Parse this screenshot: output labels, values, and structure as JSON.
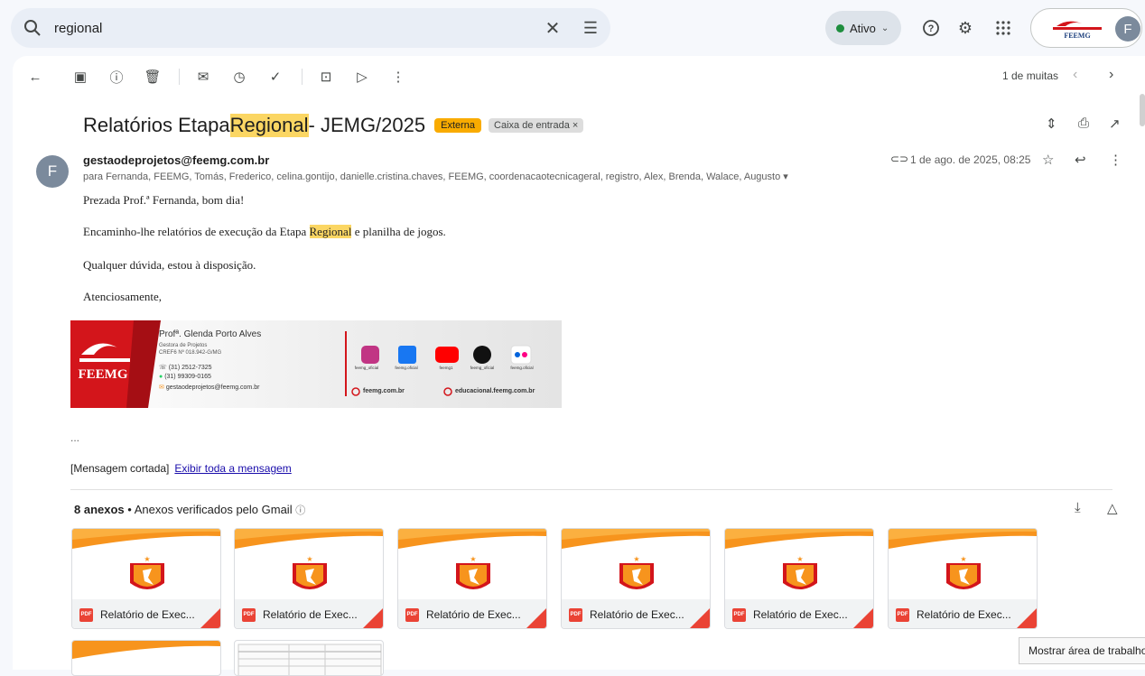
{
  "search": {
    "value": "regional"
  },
  "status": {
    "label": "Ativo"
  },
  "account": {
    "initial": "F",
    "logo_text": "FEEMG"
  },
  "toolbar": {
    "pager": "1 de muitas"
  },
  "subject": {
    "before": "Relatórios Etapa ",
    "highlight": "Regional",
    "after": " - JEMG/2025",
    "badge_external": "Externa",
    "badge_inbox": "Caixa de entrada ×"
  },
  "message": {
    "sender_initial": "F",
    "from": "gestaodeprojetos@feemg.com.br",
    "to": "para Fernanda, FEEMG, Tomás, Frederico, celina.gontijo, danielle.cristina.chaves, FEEMG, coordenacaotecnicageral, registro, Alex, Brenda, Walace, Augusto ▾",
    "date": "1 de ago. de 2025, 08:25",
    "greeting": "Prezada Prof.ª Fernanda, bom dia!",
    "line2_before": "Encaminho-lhe relatórios de execução da Etapa ",
    "line2_highlight": "Regional",
    "line2_after": " e planilha de jogos.",
    "line3": "Qualquer dúvida, estou à disposição.",
    "closing": "Atenciosamente,",
    "ellipsis": "...",
    "cut_text": "[Mensagem cortada]",
    "cut_link": "Exibir toda a mensagem"
  },
  "signature": {
    "name": "Profª. Glenda Porto Alves",
    "role": "Gestora de Projetos",
    "cref": "CREF6 Nº 018.942-G/MG",
    "phone": "(31) 2512-7325",
    "whatsapp": "(31) 99309-0165",
    "email": "gestaodeprojetos@feemg.com.br",
    "social": [
      "feemg_oficial",
      "feemg.oficial",
      "feemg1",
      "feemg_oficial",
      "feemg.oficial"
    ],
    "site1": "feemg.com.br",
    "site2": "educacional.feemg.com.br",
    "logo": "FEEMG"
  },
  "attachments": {
    "count_label": "8 anexos",
    "verified": "• Anexos verificados pelo Gmail",
    "items": [
      {
        "name": "Relatório de Exec..."
      },
      {
        "name": "Relatório de Exec..."
      },
      {
        "name": "Relatório de Exec..."
      },
      {
        "name": "Relatório de Exec..."
      },
      {
        "name": "Relatório de Exec..."
      },
      {
        "name": "Relatório de Exec..."
      }
    ]
  },
  "tooltip": {
    "text": "Mostrar área de trabalho"
  },
  "colors": {
    "highlight": "#fbd663",
    "external_badge": "#f9ab00",
    "pdf": "#ea4335",
    "brand_red": "#d3151b",
    "brand_orange": "#f7941d"
  }
}
